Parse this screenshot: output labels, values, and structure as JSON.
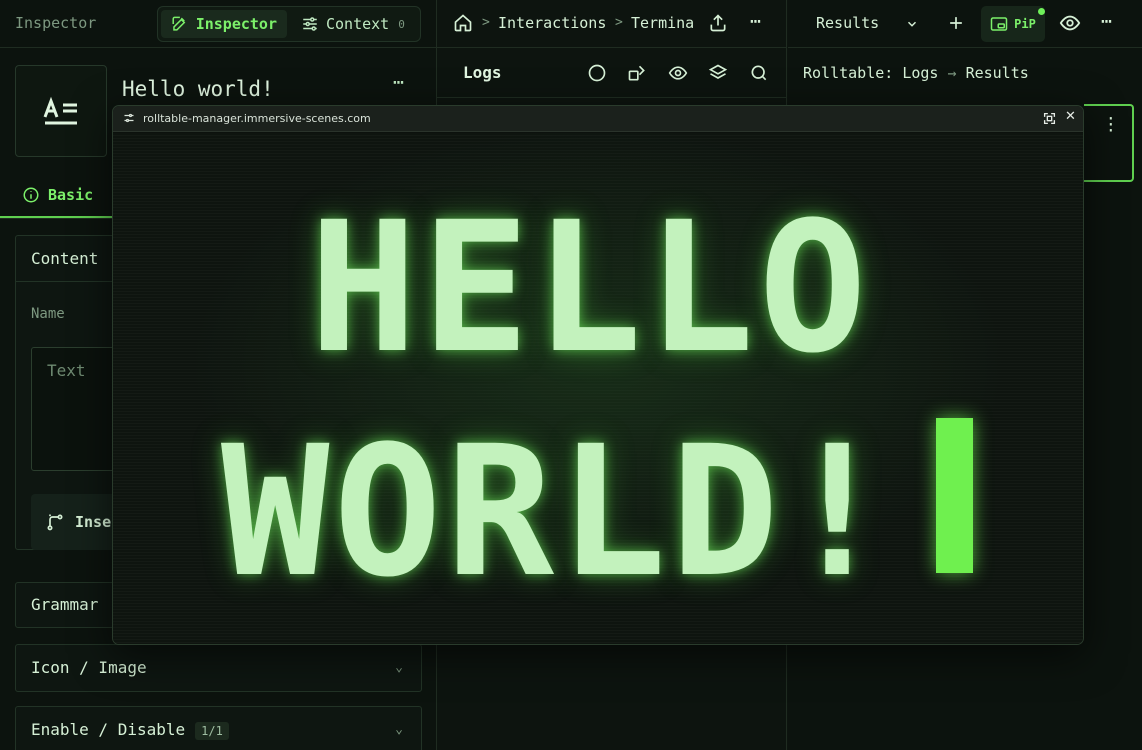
{
  "left_panel": {
    "title": "Inspector",
    "segmented": {
      "inspector_label": "Inspector",
      "context_label": "Context",
      "context_count": "0"
    },
    "node": {
      "title": "Hello world!",
      "more": "⋯"
    },
    "tab_basic": "Basic",
    "content_section": {
      "label": "Content",
      "name_label": "Name",
      "text_placeholder": "Text",
      "insert_label": "Inse"
    },
    "sections": {
      "grammar": "Grammar",
      "icon_image": "Icon / Image",
      "enable_disable": "Enable / Disable",
      "enable_badge": "1/1"
    }
  },
  "middle_panel": {
    "breadcrumb": [
      "Interactions",
      "Termina"
    ],
    "logs_title": "Logs",
    "more": "⋯"
  },
  "right_panel": {
    "results_label": "Results",
    "pip_label": "PiP",
    "breadcrumb_a": "Rolltable: Logs",
    "breadcrumb_b": "Results",
    "more": "⋯"
  },
  "pip_window": {
    "url": "rolltable-manager.immersive-scenes.com",
    "line1": "HELLO",
    "line2": "WORLD!"
  },
  "colors": {
    "accent": "#7cf06a",
    "background": "#0d140f",
    "text": "#bfe8c1"
  }
}
